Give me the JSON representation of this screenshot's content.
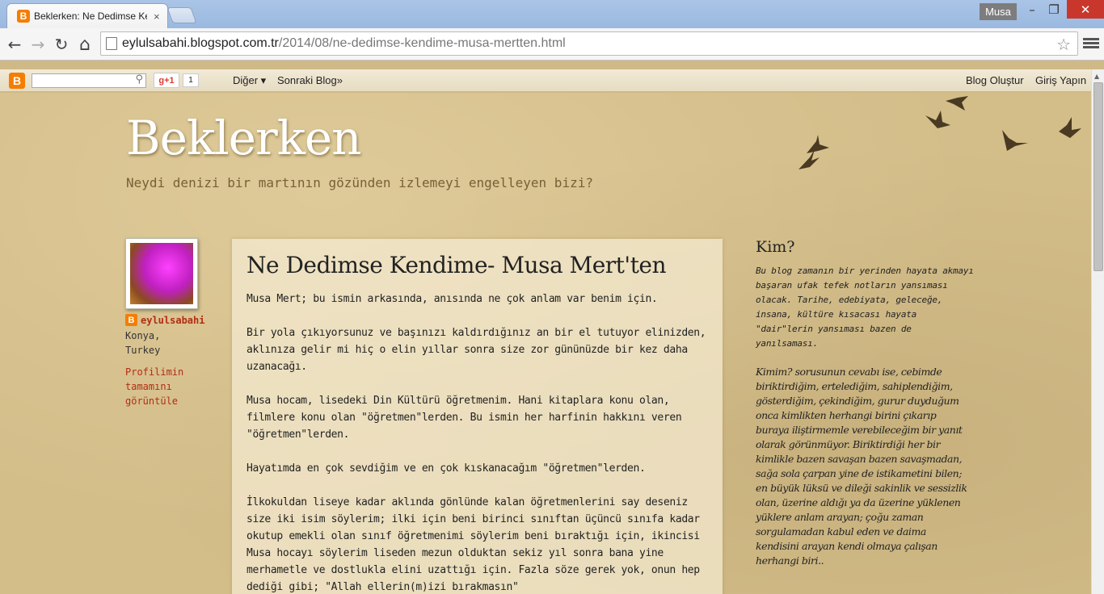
{
  "browser": {
    "tab_title": "Beklerken: Ne Dedimse Kendime- Musa Mert'ten",
    "favicon_letter": "B",
    "tab_close": "×",
    "user_badge": "Musa",
    "window_buttons": {
      "minimize": "–",
      "maximize": "❐",
      "close": "✕"
    },
    "nav": {
      "back": "←",
      "forward": "→",
      "reload": "↻",
      "home": "⌂"
    },
    "url_host": "eylulsabahi.blogspot.com.tr",
    "url_path": "/2014/08/ne-dedimse-kendime-musa-mertten.html",
    "star": "☆"
  },
  "navbar": {
    "logo_letter": "B",
    "search_icon": "⚲",
    "gplus_label": "g+1",
    "gplus_count": "1",
    "more_label": "Diğer ▾",
    "next_blog_label": "Sonraki Blog»",
    "create_blog_label": "Blog Oluştur",
    "sign_in_label": "Giriş Yapın"
  },
  "scrollbar": {
    "up_arrow": "▲"
  },
  "header": {
    "title": "Beklerken",
    "description": "Neydi denizi bir martının gözünden izlemeyi engelleyen bizi?"
  },
  "profile": {
    "icon_letter": "B",
    "name": "eylulsabahi",
    "city": "Konya,",
    "country": "Turkey",
    "view_profile": "Profilimin tamamını görüntüle"
  },
  "post": {
    "title": "Ne Dedimse Kendime- Musa Mert'ten",
    "paragraphs": [
      "Musa Mert; bu ismin arkasında, anısında ne çok anlam var benim için.",
      "Bir yola çıkıyorsunuz ve başınızı kaldırdığınız an bir el tutuyor elinizden, aklınıza gelir mi hiç o elin yıllar sonra size zor gününüzde bir kez daha uzanacağı.",
      "Musa hocam, lisedeki Din Kültürü öğretmenim. Hani kitaplara konu olan, filmlere konu olan \"öğretmen\"lerden. Bu ismin her harfinin hakkını veren \"öğretmen\"lerden.",
      "Hayatımda en çok sevdiğim ve en çok kıskanacağım \"öğretmen\"lerden.",
      "İlkokuldan liseye kadar aklında gönlünde kalan öğretmenlerini say deseniz size iki isim söylerim; ilki için beni birinci sınıftan üçüncü sınıfa kadar okutup emekli olan sınıf öğretmenimi söylerim beni bıraktığı için, ikincisi Musa hocayı söylerim liseden mezun olduktan sekiz yıl sonra bana yine merhametle ve dostlukla elini uzattığı için. Fazla söze gerek yok, onun hep dediği gibi; \"Allah ellerin(m)izi bırakmasın\""
    ]
  },
  "sidebar": {
    "title": "Kim?",
    "intro": "Bu blog zamanın bir yerinden hayata akmayı başaran ufak tefek notların yansıması olacak. Tarihe, edebiyata, geleceğe, insana, kültüre kısacası hayata \"dair\"lerin yansıması bazen de yanılsaması.",
    "answer": "Kimim? sorusunun cevabı ise, cebimde biriktirdiğim, ertelediğim, sahiplendiğim, gösterdiğim, çekindiğim, gurur duyduğum onca kimlikten herhangi birini çıkarıp buraya iliştirmemle verebileceğim bir yanıt olarak görünmüyor. Biriktirdiği her bir kimlikle bazen savaşan bazen savaşmadan, sağa sola çarpan yine de istikametini bilen; en büyük lüksü ve dileği sakinlik ve sessizlik olan, üzerine aldığı ya da üzerine yüklenen yüklere anlam arayan; çoğu zaman sorgulamadan kabul eden ve daima kendisini arayan kendi olmaya çalışan herhangi biri.."
  },
  "colors": {
    "page_background": "#d3bd89",
    "link_red": "#b22d14",
    "description_brown": "#7a5f36",
    "blogger_orange": "#f57d00",
    "close_red": "#c9372c"
  }
}
